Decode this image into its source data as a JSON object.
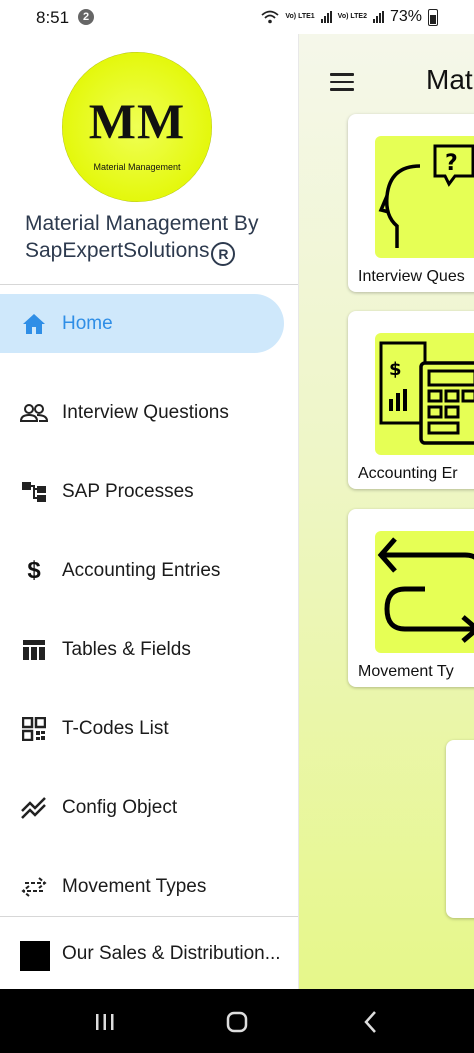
{
  "status_bar": {
    "time": "8:51",
    "notification_count": "2",
    "lte1": "Vo) LTE1",
    "lte2": "Vo) LTE2",
    "battery": "73%"
  },
  "drawer": {
    "logo_text": "MM",
    "logo_subtitle": "Material Management",
    "app_name_line1": "Material Management By",
    "app_name_line2": "SapExpertSolutions",
    "registered_symbol": "R",
    "items": [
      {
        "label": "Home",
        "icon": "home-icon"
      },
      {
        "label": "Interview Questions",
        "icon": "people-icon"
      },
      {
        "label": "SAP Processes",
        "icon": "hierarchy-icon"
      },
      {
        "label": "Accounting Entries",
        "icon": "dollar-icon"
      },
      {
        "label": "Tables & Fields",
        "icon": "table-icon"
      },
      {
        "label": "T-Codes List",
        "icon": "qr-icon"
      },
      {
        "label": "Config Object",
        "icon": "trend-icon"
      },
      {
        "label": "Movement Types",
        "icon": "swap-icon"
      }
    ],
    "footer_item": {
      "label": "Our Sales & Distribution..."
    }
  },
  "main": {
    "title": "Mat",
    "cards": [
      {
        "label": "Interview Ques",
        "icon": "head-question-icon"
      },
      {
        "label": "Accounting Er",
        "icon": "calculator-icon"
      },
      {
        "label": "Movement Ty",
        "icon": "loop-arrows-icon"
      }
    ]
  },
  "colors": {
    "accent": "#2f8ee6",
    "active_bg": "#cfe8fb",
    "tile_yellow": "#e6ff55"
  }
}
